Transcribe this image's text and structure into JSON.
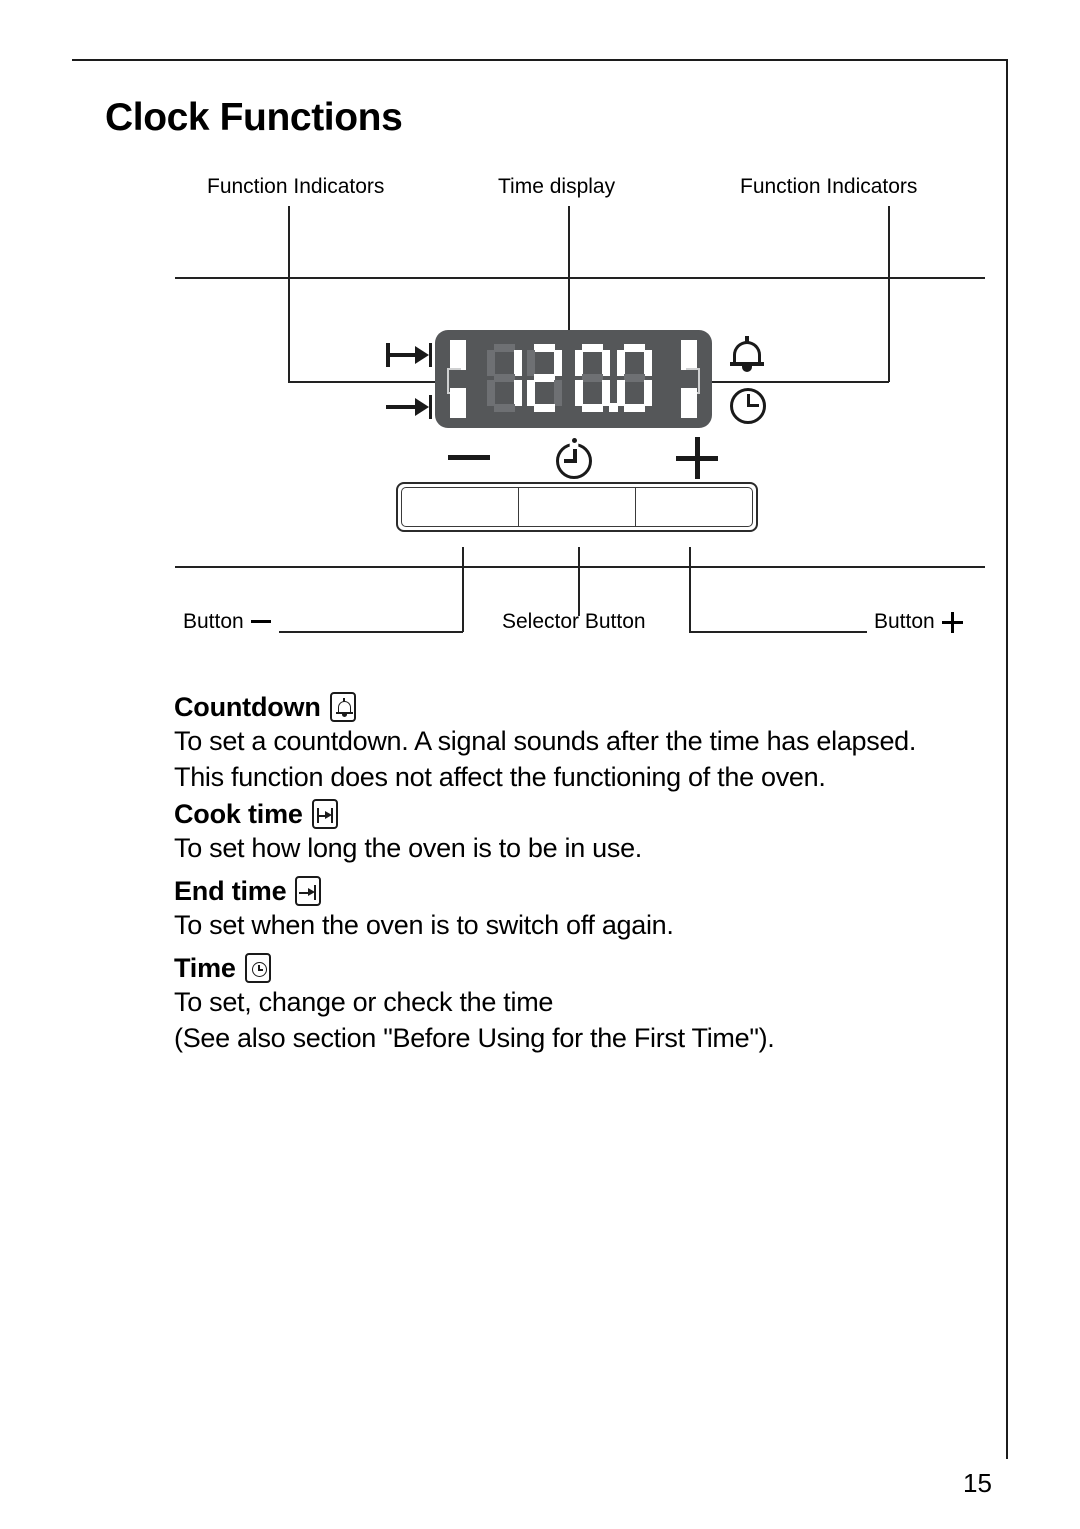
{
  "document": {
    "title": "Clock Functions",
    "page_number": "15"
  },
  "diagram": {
    "top_labels": [
      {
        "id": "function-indicators-left",
        "text": "Function Indicators"
      },
      {
        "id": "time-display",
        "text": "Time display"
      },
      {
        "id": "function-indicators-right",
        "text": "Function Indicators"
      }
    ],
    "bottom_labels": [
      {
        "id": "button-minus",
        "text": "Button",
        "symbol": "minus-icon"
      },
      {
        "id": "selector-button",
        "text": "Selector Button",
        "symbol": ""
      },
      {
        "id": "button-plus",
        "text": "Button",
        "symbol": "plus-icon"
      }
    ],
    "display": {
      "value": "12.00",
      "digits": [
        "1",
        "2",
        "0",
        "0"
      ],
      "decimal_point": ".",
      "panel_color": "#555759",
      "lit_segment_color": "#ffffff",
      "unlit_segment_color": "#6e7073"
    },
    "left_indicators": [
      {
        "id": "cook-time-indicator",
        "icon": "cook-time-icon"
      },
      {
        "id": "end-time-indicator",
        "icon": "end-time-icon"
      }
    ],
    "right_indicators": [
      {
        "id": "countdown-indicator",
        "icon": "bell-icon"
      },
      {
        "id": "time-indicator",
        "icon": "clock-icon"
      }
    ],
    "buttons": [
      {
        "id": "minus-button",
        "icon": "minus-icon"
      },
      {
        "id": "selector-button",
        "icon": "selector-clock-icon"
      },
      {
        "id": "plus-button",
        "icon": "plus-icon"
      }
    ]
  },
  "sections": [
    {
      "id": "countdown",
      "heading": "Countdown",
      "icon": "bell-icon",
      "lines": [
        "To set a countdown. A signal sounds after the time has elapsed.",
        "This function does not affect the functioning of the oven."
      ]
    },
    {
      "id": "cook-time",
      "heading": "Cook time",
      "icon": "cook-time-icon",
      "lines": [
        "To set how long the oven is to be in use."
      ]
    },
    {
      "id": "end-time",
      "heading": "End time",
      "icon": "end-time-icon",
      "lines": [
        "To set when the oven is to switch off again."
      ]
    },
    {
      "id": "time",
      "heading": "Time",
      "icon": "clock-icon",
      "lines": [
        "To set, change or check the time",
        "(See also section \"Before Using for the First Time\")."
      ]
    }
  ]
}
